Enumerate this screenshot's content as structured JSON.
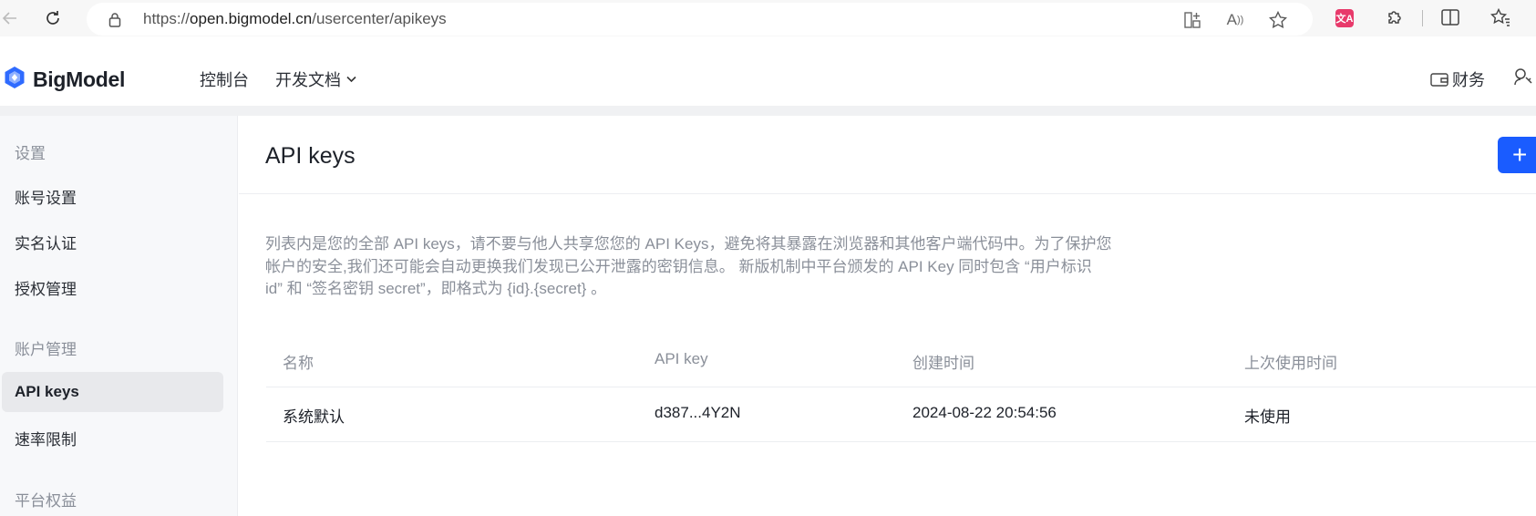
{
  "browser": {
    "url_prefix": "https://",
    "url_host": "open.bigmodel.cn",
    "url_path": "/usercenter/apikeys",
    "icons": [
      "back-icon",
      "refresh-icon",
      "lock-icon",
      "split-view-icon",
      "read-aloud-icon",
      "favorite-star-icon",
      "translate-icon",
      "extensions-icon",
      "split-screen-icon",
      "favorites-icon"
    ]
  },
  "header": {
    "logo_text": "BigModel",
    "nav": [
      {
        "label": "控制台"
      },
      {
        "label": "开发文档"
      }
    ],
    "right": {
      "finance_label": "财务"
    }
  },
  "sidebar": {
    "groups": [
      {
        "title": "设置",
        "items": [
          {
            "label": "账号设置"
          },
          {
            "label": "实名认证"
          },
          {
            "label": "授权管理"
          }
        ]
      },
      {
        "title": "账户管理",
        "items": [
          {
            "label": "API keys",
            "active": true
          },
          {
            "label": "速率限制"
          }
        ]
      },
      {
        "title": "平台权益",
        "items": []
      }
    ]
  },
  "main": {
    "title": "API keys",
    "add_button_label": "+",
    "description": "列表内是您的全部 API keys，请不要与他人共享您您的 API Keys，避免将其暴露在浏览器和其他客户端代码中。为了保护您帐户的安全,我们还可能会自动更换我们发现已公开泄露的密钥信息。 新版机制中平台颁发的 API Key 同时包含 “用户标识 id” 和 “签名密钥 secret”，即格式为 {id}.{secret} 。",
    "table": {
      "columns": [
        "名称",
        "API key",
        "创建时间",
        "上次使用时间"
      ],
      "rows": [
        [
          "系统默认",
          "d387...4Y2N",
          "2024-08-22 20:54:56",
          "未使用"
        ]
      ]
    }
  },
  "colors": {
    "accent": "#1a5cff",
    "sidebar_bg": "#f7f8fa",
    "active_item": "#e8e9ec"
  }
}
